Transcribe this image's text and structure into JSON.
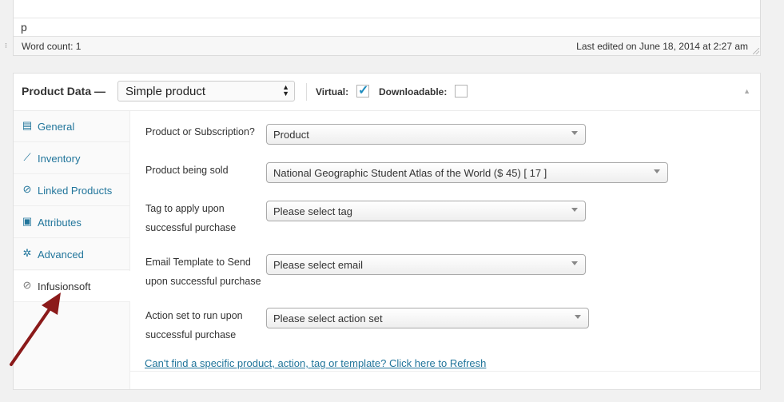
{
  "editor": {
    "content": "p",
    "word_count": "Word count: 1",
    "last_edited": "Last edited on June 18, 2014 at 2:27 am"
  },
  "product_data": {
    "title": "Product Data —",
    "type_value": "Simple product",
    "virtual_label": "Virtual:",
    "virtual_checked": true,
    "downloadable_label": "Downloadable:",
    "downloadable_checked": false
  },
  "tabs": [
    {
      "label": "General",
      "icon": "grid-icon"
    },
    {
      "label": "Inventory",
      "icon": "chart-icon"
    },
    {
      "label": "Linked Products",
      "icon": "link-icon"
    },
    {
      "label": "Attributes",
      "icon": "list-icon"
    },
    {
      "label": "Advanced",
      "icon": "gear-icon"
    },
    {
      "label": "Infusionsoft",
      "icon": "link-icon"
    }
  ],
  "fields": {
    "product_or_subscription": {
      "label": "Product or Subscription?",
      "value": "Product"
    },
    "product_sold": {
      "label": "Product being sold",
      "value": "National Geographic Student Atlas of the World ($ 45) [ 17 ]"
    },
    "tag": {
      "label1": "Tag to apply upon",
      "label2": "successful purchase",
      "value": "Please select tag"
    },
    "email": {
      "label1": "Email Template to Send",
      "label2": "upon successful purchase",
      "value": "Please select email"
    },
    "action": {
      "label1": "Action set to run upon",
      "label2": "successful purchase",
      "value": "Please select action set"
    }
  },
  "refresh_link": "Can't find a specific product, action, tag or template? Click here to Refresh",
  "colors": {
    "link": "#21759b",
    "arrow": "#8b1a1a"
  }
}
